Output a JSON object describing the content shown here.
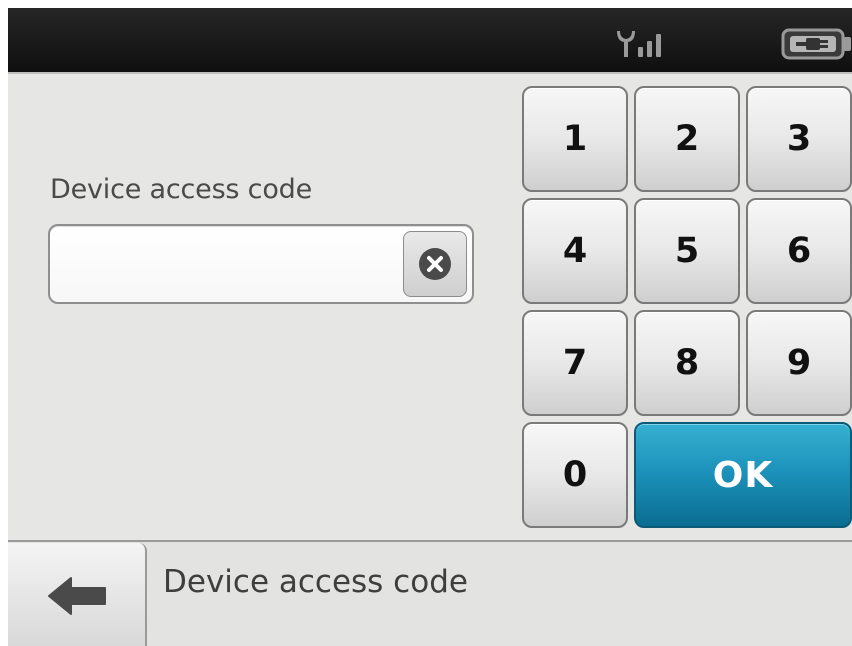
{
  "status_bar": {
    "signal_icon": "signal-strength-icon",
    "battery_icon": "battery-plugged-icon"
  },
  "form": {
    "label": "Device access code",
    "input_value": "",
    "input_placeholder": "",
    "clear_icon": "clear-x-icon"
  },
  "keypad": {
    "keys": [
      "1",
      "2",
      "3",
      "4",
      "5",
      "6",
      "7",
      "8",
      "9",
      "0"
    ],
    "ok_label": "OK",
    "ok_color": "#1d93bb"
  },
  "bottom_bar": {
    "back_icon": "back-arrow-icon",
    "title": "Device access code"
  }
}
